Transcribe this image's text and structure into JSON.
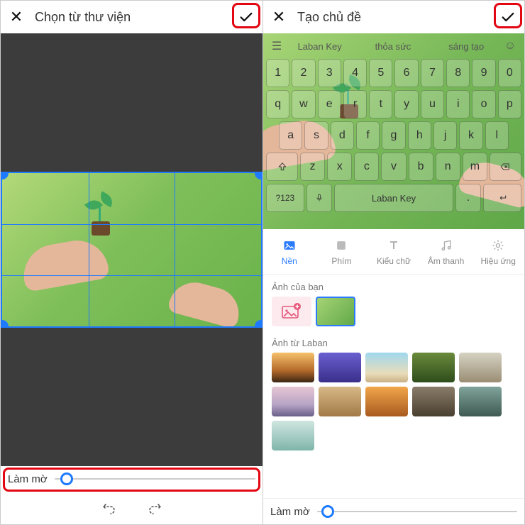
{
  "left": {
    "title": "Chọn từ thư viện",
    "slider_label": "Làm mờ",
    "slider_value": 8
  },
  "right": {
    "title": "Tạo chủ đề",
    "suggestions": {
      "s1": "Laban Key",
      "s2": "thỏa sức",
      "s3": "sáng tạo"
    },
    "keyboard": {
      "row1": [
        "1",
        "2",
        "3",
        "4",
        "5",
        "6",
        "7",
        "8",
        "9",
        "0"
      ],
      "row2": [
        "q",
        "w",
        "e",
        "r",
        "t",
        "y",
        "u",
        "i",
        "o",
        "p"
      ],
      "row3": [
        "a",
        "s",
        "d",
        "f",
        "g",
        "h",
        "j",
        "k",
        "l"
      ],
      "row4_mid": [
        "z",
        "x",
        "c",
        "v",
        "b",
        "n",
        "m"
      ],
      "mode": "?123",
      "space": "Laban Key",
      "dot": "."
    },
    "tabs": {
      "nen": "Nền",
      "phim": "Phím",
      "kieu_chu": "Kiểu chữ",
      "am_thanh": "Âm thanh",
      "hieu_ung": "Hiệu ứng"
    },
    "section_user": "Ảnh của bạn",
    "section_laban": "Ảnh từ Laban",
    "slider_label": "Làm mờ",
    "slider_value": 6
  }
}
